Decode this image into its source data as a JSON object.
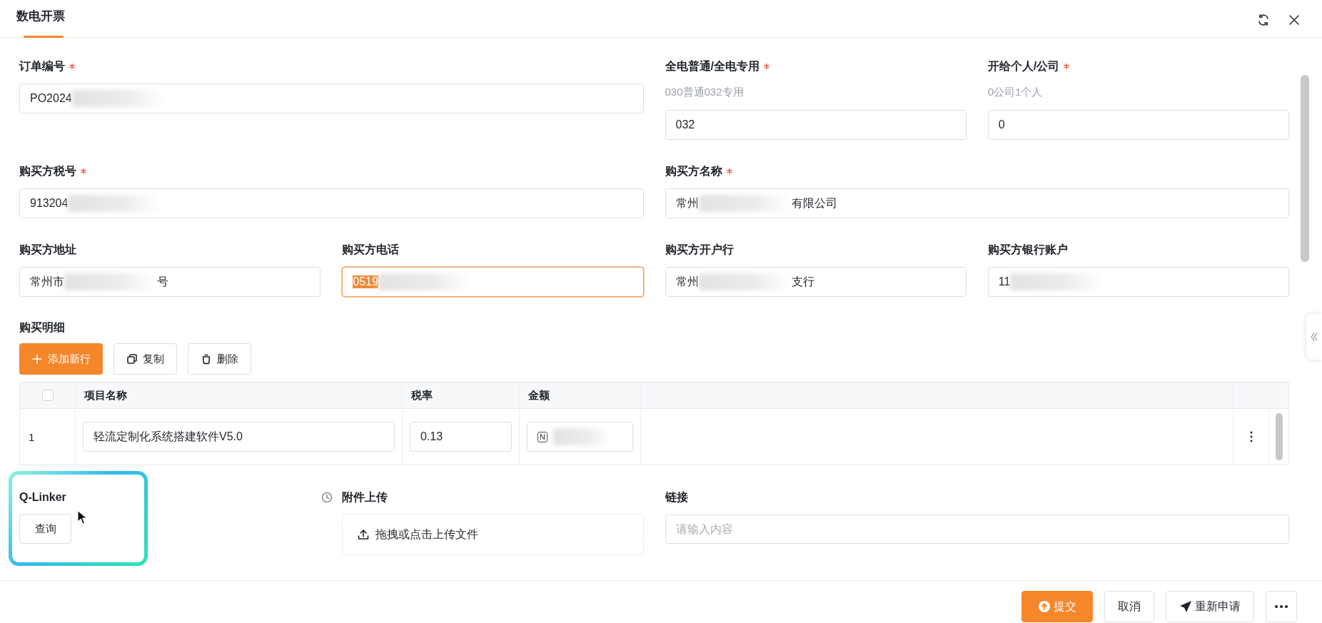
{
  "window": {
    "tabs": [
      {
        "label": "数电开票",
        "selected": true
      }
    ]
  },
  "form": {
    "rows": [
      [
        {
          "label": "订单编号",
          "required": true,
          "value": "PO2024",
          "redacted": true,
          "focused": false,
          "text_selected": false
        },
        "",
        {
          "label": "全电普通/全电专用",
          "required": true,
          "hint": "030普通032专用",
          "value": "032",
          "redacted": false,
          "focused": false,
          "text_selected": false
        },
        {
          "label": "开给个人/公司",
          "required": true,
          "hint": "0公司1个人",
          "value": "0",
          "redacted": false,
          "focused": false,
          "text_selected": false
        }
      ],
      [
        {
          "label": "购买方税号",
          "required": true,
          "value": "913204",
          "redacted": true,
          "focused": false,
          "text_selected": false
        },
        "",
        {
          "label": "购买方名称",
          "required": true,
          "value": "常州",
          "redacted": true,
          "value_after": "有限公司",
          "focused": false,
          "text_selected": false
        },
        ""
      ],
      [
        {
          "label": "购买方地址",
          "required": false,
          "value": "常州市",
          "redacted": true,
          "value_after": "号",
          "focused": false,
          "text_selected": false
        },
        {
          "label": "购买方电话",
          "required": false,
          "value": "0519",
          "redacted": true,
          "focused": true,
          "text_selected": true
        },
        {
          "label": "购买方开户行",
          "required": false,
          "value": "常州",
          "redacted": true,
          "value_after": "支行",
          "focused": false,
          "text_selected": false
        },
        {
          "label": "购买方银行账户",
          "required": false,
          "value": "11",
          "redacted": true,
          "focused": false,
          "text_selected": false
        }
      ]
    ]
  },
  "details": {
    "title": "购买明细",
    "toolbar": [
      {
        "label": "添加新行",
        "kind": "primary"
      },
      {
        "label": "复制",
        "kind": "default"
      },
      {
        "label": "删除",
        "kind": "default"
      }
    ],
    "table": {
      "select_all_checked": false,
      "columns": [
        "项目名称",
        "税率",
        "金额"
      ],
      "rows": [
        {
          "index": "1",
          "checked": false,
          "name": "轻流定制化系统搭建软件V5.0",
          "rate": "0.13",
          "amount_prefix": "N",
          "amount_redacted": true
        }
      ]
    }
  },
  "qlinker": {
    "label": "Q-Linker",
    "button": "查询",
    "highlighted": true
  },
  "attachment": {
    "label": "附件上传",
    "upload": "拖拽或点击上传文件"
  },
  "link": {
    "label": "链接",
    "placeholder": "请输入内容"
  },
  "footer": {
    "buttons": [
      {
        "label": "提交",
        "kind": "primary"
      },
      {
        "label": "取消",
        "kind": "default"
      },
      {
        "label": "重新申请",
        "kind": "send"
      },
      {
        "kind": "more"
      }
    ]
  }
}
